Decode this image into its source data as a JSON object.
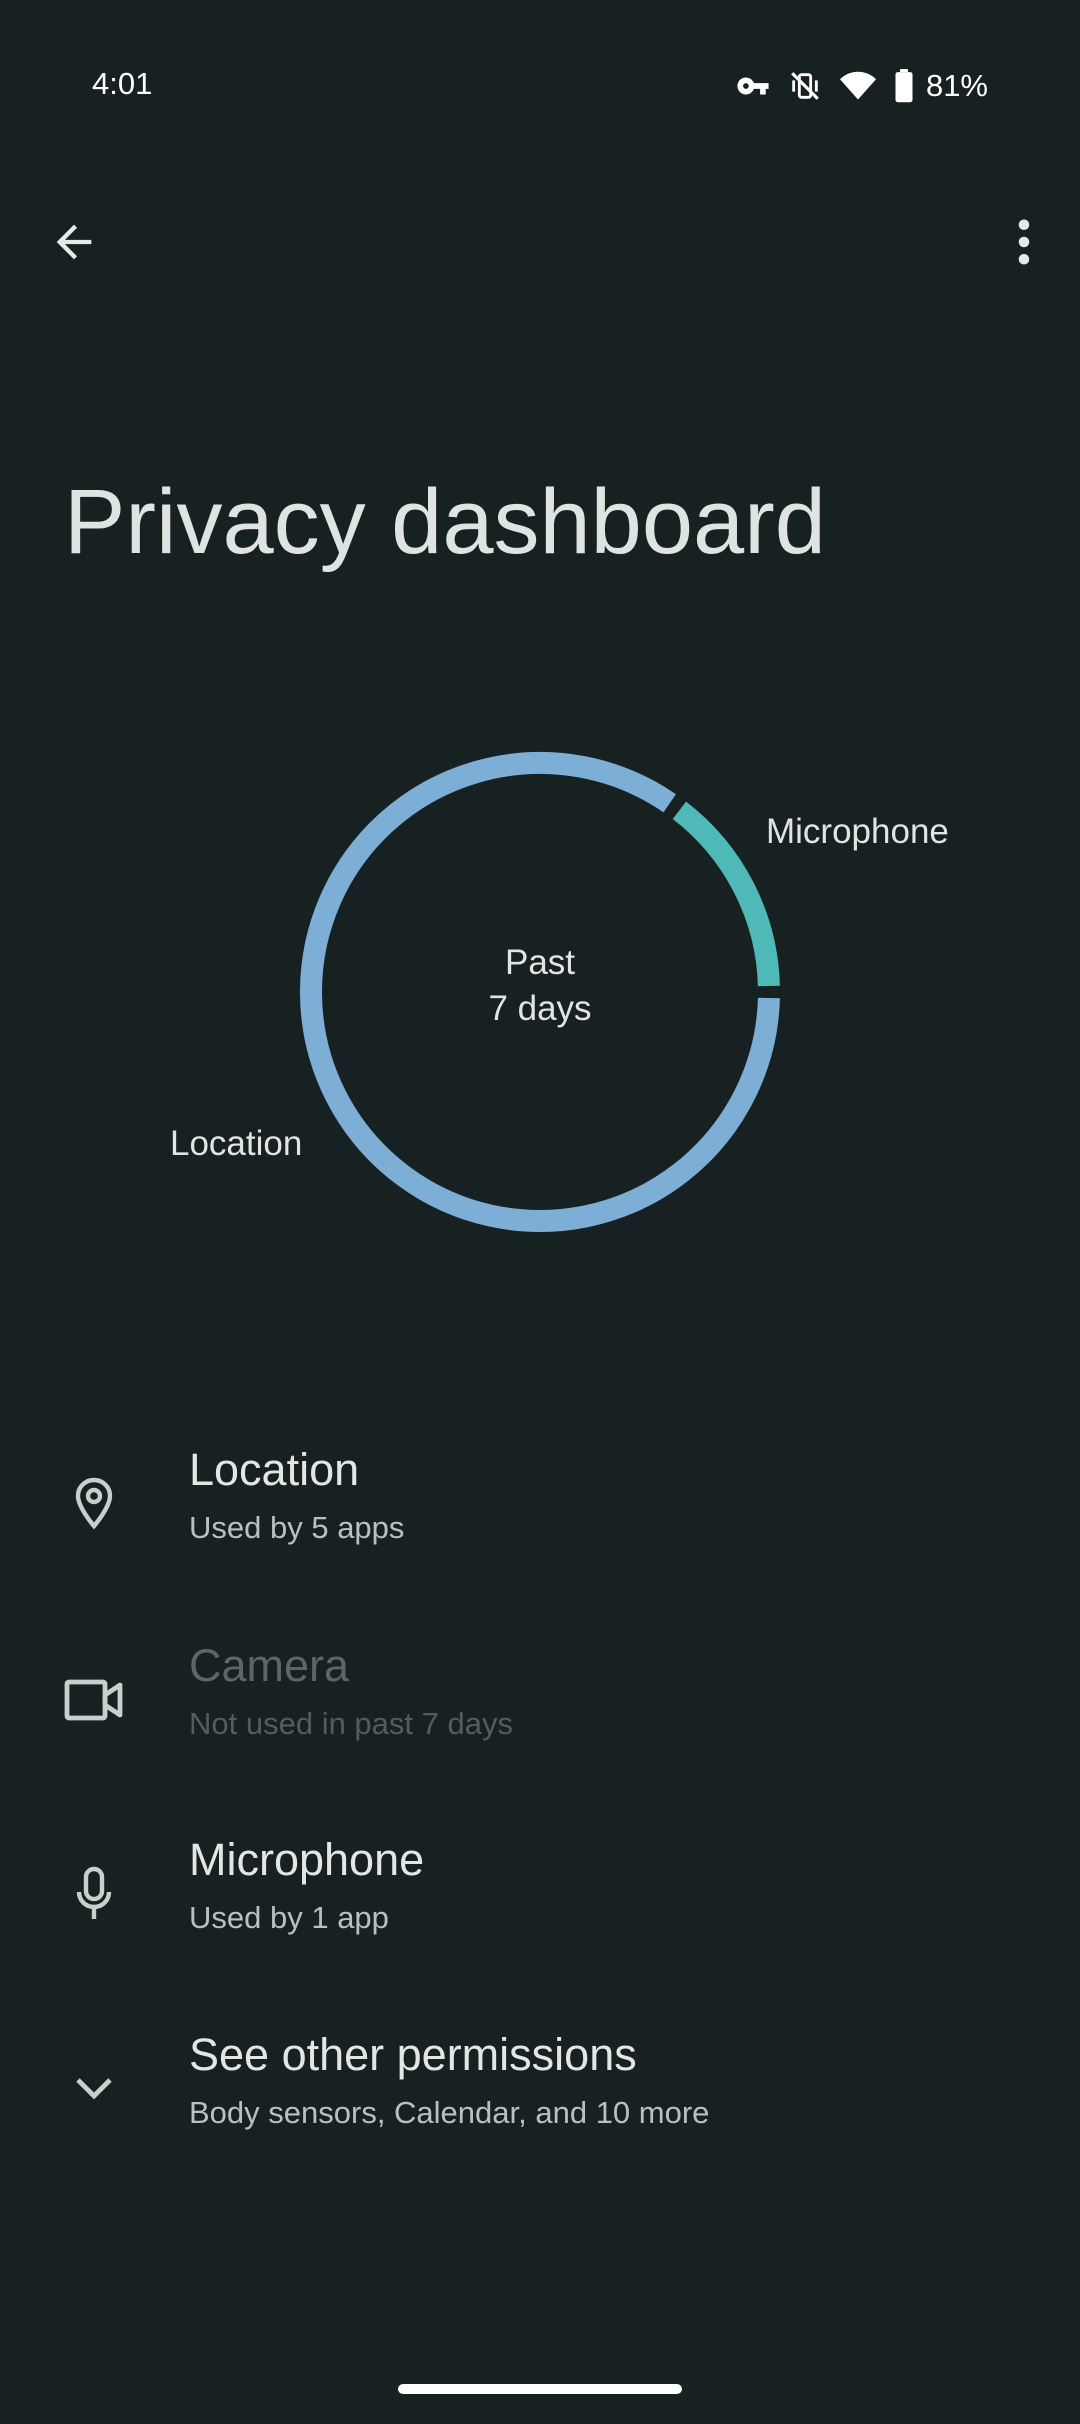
{
  "status_bar": {
    "time": "4:01",
    "battery_percent": "81%",
    "icons": [
      "vpn-key-icon",
      "vibrate-off-icon",
      "wifi-icon",
      "battery-icon"
    ]
  },
  "app_bar": {
    "back_icon": "arrow-back-icon",
    "menu_icon": "more-vert-icon"
  },
  "title": "Privacy dashboard",
  "chart_data": {
    "type": "pie",
    "center_label_line1": "Past",
    "center_label_line2": "7 days",
    "slices": [
      {
        "label": "Microphone",
        "value": 15,
        "color": "#4fb9b8"
      },
      {
        "label": "Location",
        "value": 85,
        "color": "#7daed6"
      }
    ]
  },
  "permissions": [
    {
      "title": "Location",
      "subtitle": "Used by 5 apps",
      "icon": "location-pin-icon",
      "enabled": true
    },
    {
      "title": "Camera",
      "subtitle": "Not used in past 7 days",
      "icon": "camera-icon",
      "enabled": false
    },
    {
      "title": "Microphone",
      "subtitle": "Used by 1 app",
      "icon": "microphone-icon",
      "enabled": true
    },
    {
      "title": "See other permissions",
      "subtitle": "Body sensors, Calendar, and 10 more",
      "icon": "chevron-down-icon",
      "enabled": true
    }
  ]
}
